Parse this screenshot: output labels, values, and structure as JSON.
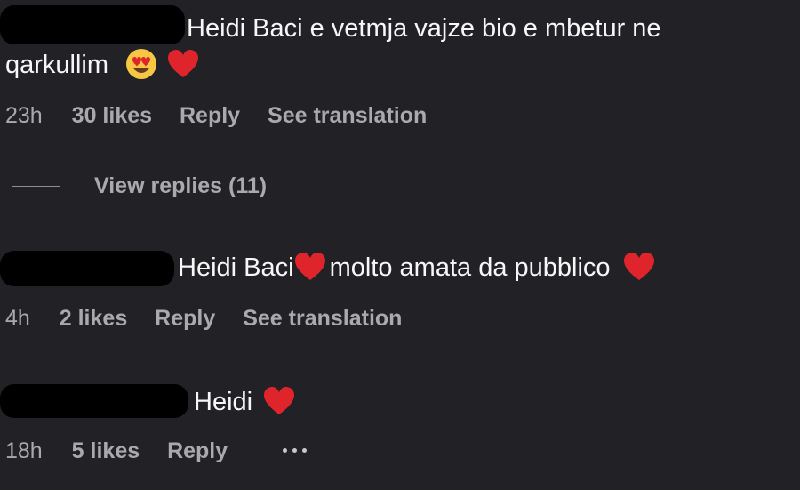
{
  "comments": [
    {
      "text_line1": "Heidi Baci e vetmja vajze bio e mbetur ne",
      "text_line2": "qarkullim",
      "time": "23h",
      "likes": "30 likes",
      "reply": "Reply",
      "translation": "See translation"
    },
    {
      "text_part1": "Heidi Baci",
      "text_part2": "molto amata da pubblico",
      "time": "4h",
      "likes": "2 likes",
      "reply": "Reply",
      "translation": "See translation"
    },
    {
      "text": "Heidi",
      "time": "18h",
      "likes": "5 likes",
      "reply": "Reply"
    }
  ],
  "view_replies": "View replies (11)",
  "icons": {
    "heart": "red-heart-icon",
    "heart_eyes": "heart-eyes-emoji-icon",
    "more": "more-options-icon"
  },
  "colors": {
    "background": "#222126",
    "text": "#f7f7f7",
    "meta": "#a9a9ae",
    "heart": "#e0242b",
    "emoji_face": "#f7c744"
  }
}
